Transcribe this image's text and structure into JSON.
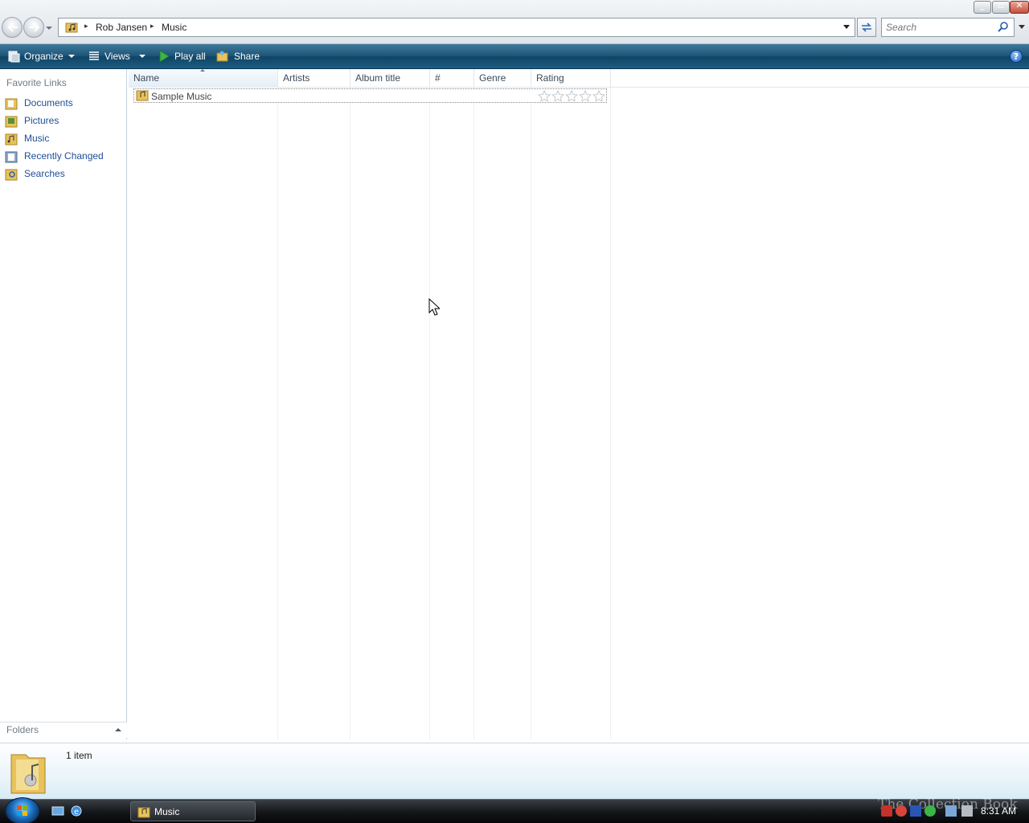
{
  "address": {
    "crumbs": [
      "Rob Jansen",
      "Music"
    ]
  },
  "search": {
    "placeholder": "Search"
  },
  "toolbar": {
    "organize_label": "Organize",
    "views_label": "Views",
    "play_all_label": "Play all",
    "share_label": "Share",
    "help_label": "?"
  },
  "sidebar": {
    "favorites_title": "Favorite Links",
    "items": [
      {
        "label": "Documents",
        "icon": "documents-folder-icon"
      },
      {
        "label": "Pictures",
        "icon": "pictures-folder-icon"
      },
      {
        "label": "Music",
        "icon": "music-folder-icon"
      },
      {
        "label": "Recently Changed",
        "icon": "recently-changed-icon"
      },
      {
        "label": "Searches",
        "icon": "searches-folder-icon"
      }
    ],
    "folders_label": "Folders"
  },
  "table": {
    "columns": [
      "Name",
      "Artists",
      "Album title",
      "#",
      "Genre",
      "Rating"
    ],
    "sorted_column": "Name",
    "rows": [
      {
        "name": "Sample Music",
        "artists": "",
        "album": "",
        "track": "",
        "genre": "",
        "rating": 0
      }
    ]
  },
  "details": {
    "item_count": "1 item"
  },
  "taskbar": {
    "active_window": "Music",
    "clock": "8:31 AM",
    "watermark": "The Collection Book"
  },
  "colors": {
    "toolbar": "#1d5577",
    "link": "#1f4e99",
    "folder": "#e8c25a"
  }
}
